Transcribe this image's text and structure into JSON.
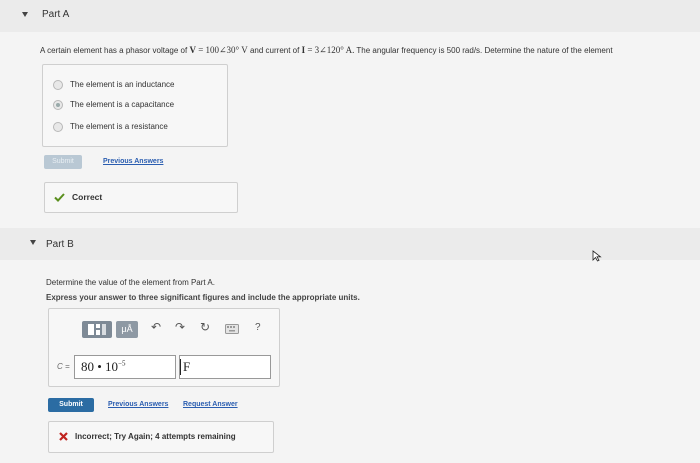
{
  "part_a": {
    "header": "Part A",
    "question_prefix": "A certain element has a phasor voltage of",
    "voltage_symbol": "V",
    "voltage_value": "= 100∠30° V",
    "current_connector": "and current of",
    "current_symbol": "I",
    "current_value": "= 3∠120° A.",
    "question_suffix": "The angular frequency is 500 rad/s. Determine the nature of the element",
    "choices": [
      {
        "label": "The element is an inductance",
        "selected": false
      },
      {
        "label": "The element is a capacitance",
        "selected": true
      },
      {
        "label": "The element is a resistance",
        "selected": false
      }
    ],
    "submit_label": "Submit",
    "previous_answers": "Previous Answers",
    "feedback": "Correct"
  },
  "part_b": {
    "header": "Part B",
    "instruction_1": "Determine the value of the element from Part A.",
    "instruction_2": "Express your answer to three significant figures and include the appropriate units.",
    "toolbar": {
      "units_label": "μÅ",
      "help_label": "?"
    },
    "variable_label": "C =",
    "value_mantissa": "80 • 10",
    "value_exponent": "−5",
    "unit_value": "F",
    "submit_label": "Submit",
    "previous_answers": "Previous Answers",
    "request_answer": "Request Answer",
    "feedback": "Incorrect; Try Again; 4 attempts remaining"
  },
  "colors": {
    "submit_active": "#2b6ca3",
    "submit_disabled": "#b9c8d4",
    "correct_check": "#5a8f1e",
    "incorrect_x": "#c0231f",
    "link": "#2a5db0"
  }
}
